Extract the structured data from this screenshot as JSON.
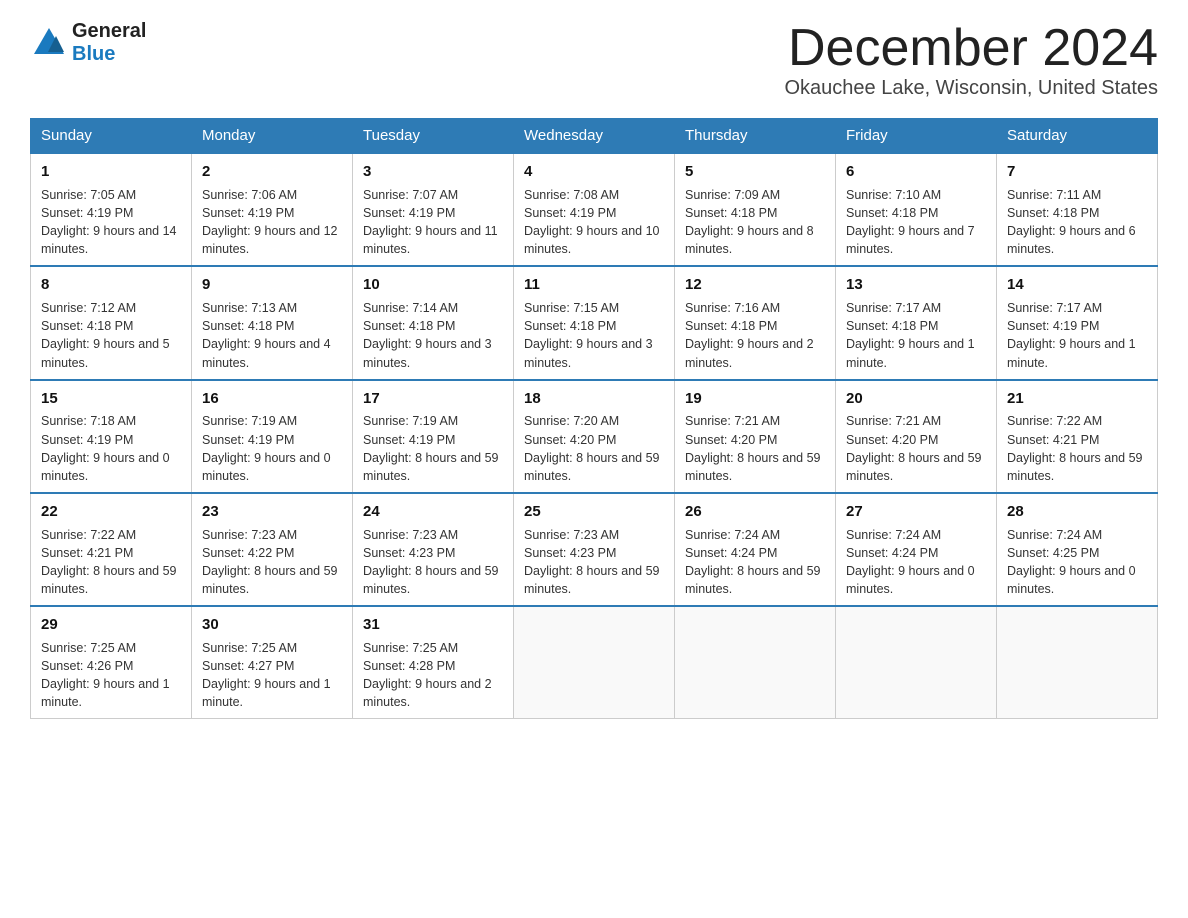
{
  "header": {
    "logo_general": "General",
    "logo_blue": "Blue",
    "month_title": "December 2024",
    "location": "Okauchee Lake, Wisconsin, United States"
  },
  "days_of_week": [
    "Sunday",
    "Monday",
    "Tuesday",
    "Wednesday",
    "Thursday",
    "Friday",
    "Saturday"
  ],
  "weeks": [
    [
      {
        "day": "1",
        "sunrise": "7:05 AM",
        "sunset": "4:19 PM",
        "daylight": "9 hours and 14 minutes."
      },
      {
        "day": "2",
        "sunrise": "7:06 AM",
        "sunset": "4:19 PM",
        "daylight": "9 hours and 12 minutes."
      },
      {
        "day": "3",
        "sunrise": "7:07 AM",
        "sunset": "4:19 PM",
        "daylight": "9 hours and 11 minutes."
      },
      {
        "day": "4",
        "sunrise": "7:08 AM",
        "sunset": "4:19 PM",
        "daylight": "9 hours and 10 minutes."
      },
      {
        "day": "5",
        "sunrise": "7:09 AM",
        "sunset": "4:18 PM",
        "daylight": "9 hours and 8 minutes."
      },
      {
        "day": "6",
        "sunrise": "7:10 AM",
        "sunset": "4:18 PM",
        "daylight": "9 hours and 7 minutes."
      },
      {
        "day": "7",
        "sunrise": "7:11 AM",
        "sunset": "4:18 PM",
        "daylight": "9 hours and 6 minutes."
      }
    ],
    [
      {
        "day": "8",
        "sunrise": "7:12 AM",
        "sunset": "4:18 PM",
        "daylight": "9 hours and 5 minutes."
      },
      {
        "day": "9",
        "sunrise": "7:13 AM",
        "sunset": "4:18 PM",
        "daylight": "9 hours and 4 minutes."
      },
      {
        "day": "10",
        "sunrise": "7:14 AM",
        "sunset": "4:18 PM",
        "daylight": "9 hours and 3 minutes."
      },
      {
        "day": "11",
        "sunrise": "7:15 AM",
        "sunset": "4:18 PM",
        "daylight": "9 hours and 3 minutes."
      },
      {
        "day": "12",
        "sunrise": "7:16 AM",
        "sunset": "4:18 PM",
        "daylight": "9 hours and 2 minutes."
      },
      {
        "day": "13",
        "sunrise": "7:17 AM",
        "sunset": "4:18 PM",
        "daylight": "9 hours and 1 minute."
      },
      {
        "day": "14",
        "sunrise": "7:17 AM",
        "sunset": "4:19 PM",
        "daylight": "9 hours and 1 minute."
      }
    ],
    [
      {
        "day": "15",
        "sunrise": "7:18 AM",
        "sunset": "4:19 PM",
        "daylight": "9 hours and 0 minutes."
      },
      {
        "day": "16",
        "sunrise": "7:19 AM",
        "sunset": "4:19 PM",
        "daylight": "9 hours and 0 minutes."
      },
      {
        "day": "17",
        "sunrise": "7:19 AM",
        "sunset": "4:19 PM",
        "daylight": "8 hours and 59 minutes."
      },
      {
        "day": "18",
        "sunrise": "7:20 AM",
        "sunset": "4:20 PM",
        "daylight": "8 hours and 59 minutes."
      },
      {
        "day": "19",
        "sunrise": "7:21 AM",
        "sunset": "4:20 PM",
        "daylight": "8 hours and 59 minutes."
      },
      {
        "day": "20",
        "sunrise": "7:21 AM",
        "sunset": "4:20 PM",
        "daylight": "8 hours and 59 minutes."
      },
      {
        "day": "21",
        "sunrise": "7:22 AM",
        "sunset": "4:21 PM",
        "daylight": "8 hours and 59 minutes."
      }
    ],
    [
      {
        "day": "22",
        "sunrise": "7:22 AM",
        "sunset": "4:21 PM",
        "daylight": "8 hours and 59 minutes."
      },
      {
        "day": "23",
        "sunrise": "7:23 AM",
        "sunset": "4:22 PM",
        "daylight": "8 hours and 59 minutes."
      },
      {
        "day": "24",
        "sunrise": "7:23 AM",
        "sunset": "4:23 PM",
        "daylight": "8 hours and 59 minutes."
      },
      {
        "day": "25",
        "sunrise": "7:23 AM",
        "sunset": "4:23 PM",
        "daylight": "8 hours and 59 minutes."
      },
      {
        "day": "26",
        "sunrise": "7:24 AM",
        "sunset": "4:24 PM",
        "daylight": "8 hours and 59 minutes."
      },
      {
        "day": "27",
        "sunrise": "7:24 AM",
        "sunset": "4:24 PM",
        "daylight": "9 hours and 0 minutes."
      },
      {
        "day": "28",
        "sunrise": "7:24 AM",
        "sunset": "4:25 PM",
        "daylight": "9 hours and 0 minutes."
      }
    ],
    [
      {
        "day": "29",
        "sunrise": "7:25 AM",
        "sunset": "4:26 PM",
        "daylight": "9 hours and 1 minute."
      },
      {
        "day": "30",
        "sunrise": "7:25 AM",
        "sunset": "4:27 PM",
        "daylight": "9 hours and 1 minute."
      },
      {
        "day": "31",
        "sunrise": "7:25 AM",
        "sunset": "4:28 PM",
        "daylight": "9 hours and 2 minutes."
      },
      null,
      null,
      null,
      null
    ]
  ]
}
